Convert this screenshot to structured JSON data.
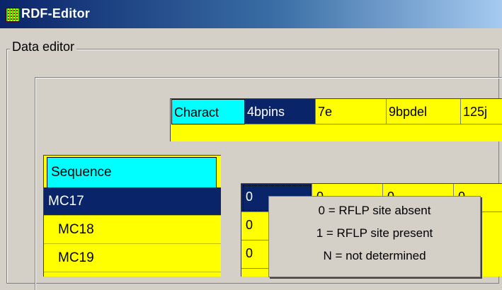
{
  "window": {
    "title": "RDF-Editor",
    "icon": "grid-app-icon"
  },
  "group": {
    "label": "Data editor"
  },
  "columns": [
    "Charact",
    "4bpins",
    "7e",
    "9bpdel",
    "125j"
  ],
  "rows": {
    "header": "Sequence",
    "items": [
      "MC17",
      "MC18",
      "MC19"
    ],
    "selected": "MC17"
  },
  "grid": {
    "cells": [
      [
        "0",
        "0",
        "0",
        "0"
      ],
      [
        "0",
        "",
        "",
        ""
      ],
      [
        "0",
        "",
        "",
        ""
      ]
    ]
  },
  "tooltip": {
    "lines": [
      "0 = RFLP site absent",
      "1 = RFLP site present",
      "N = not determined"
    ]
  },
  "colors": {
    "titlebar": "#0a246a",
    "header_cyan": "#00ffff",
    "cell_yellow": "#ffff00",
    "selection_navy": "#0a246a"
  }
}
